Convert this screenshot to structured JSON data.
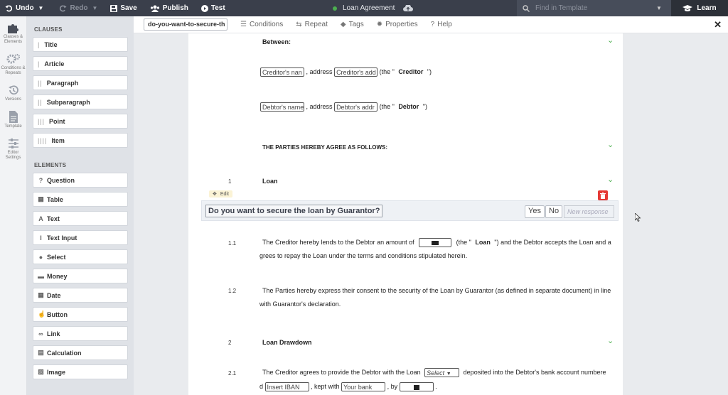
{
  "toolbar": {
    "undo": "Undo",
    "redo": "Redo",
    "save": "Save",
    "publish": "Publish",
    "test": "Test",
    "doc_title": "Loan Agreement",
    "search_placeholder": "Find in Template",
    "learn": "Learn"
  },
  "rail": [
    {
      "label": "Clauses & Elements",
      "icon": "puzzle-icon"
    },
    {
      "label": "Conditions & Repeats",
      "icon": "gears-icon"
    },
    {
      "label": "Versions",
      "icon": "history-icon"
    },
    {
      "label": "Template",
      "icon": "document-icon"
    },
    {
      "label": "Editor Settings",
      "icon": "sliders-icon"
    }
  ],
  "clauses": {
    "heading": "CLAUSES",
    "items": [
      {
        "label": "Title",
        "bars": "|"
      },
      {
        "label": "Article",
        "bars": "|"
      },
      {
        "label": "Paragraph",
        "bars": "||"
      },
      {
        "label": "Subparagraph",
        "bars": "||"
      },
      {
        "label": "Point",
        "bars": "|||"
      },
      {
        "label": "Item",
        "bars": "||||"
      }
    ]
  },
  "elements": {
    "heading": "ELEMENTS",
    "items": [
      {
        "label": "Question",
        "glyph": "?"
      },
      {
        "label": "Table",
        "glyph": "▦"
      },
      {
        "label": "Text",
        "glyph": "A"
      },
      {
        "label": "Text Input",
        "glyph": "I"
      },
      {
        "label": "Select",
        "glyph": "●"
      },
      {
        "label": "Money",
        "glyph": "▬"
      },
      {
        "label": "Date",
        "glyph": "▦"
      },
      {
        "label": "Button",
        "glyph": "☝"
      },
      {
        "label": "Link",
        "glyph": "∞"
      },
      {
        "label": "Calculation",
        "glyph": "▤"
      },
      {
        "label": "Image",
        "glyph": "▨"
      }
    ]
  },
  "subbar": {
    "element_id": "do-you-want-to-secure-th",
    "conditions": "Conditions",
    "repeat": "Repeat",
    "tags": "Tags",
    "properties": "Properties",
    "help": "Help"
  },
  "doc": {
    "between": "Between:",
    "creditor_name": "Creditor's nan",
    "creditor_addr": "Creditor's add",
    "address_word": ", address",
    "the_open": "(the \"",
    "close_paren": "\")",
    "creditor": "Creditor",
    "debtor_name": "Debtor's name",
    "debtor_addr": "Debtor's addr",
    "debtor": "Debtor",
    "agree": "THE PARTIES HEREBY AGREE AS FOLLOWS:",
    "num1": "1",
    "loan_heading": "Loan",
    "edit": "Edit",
    "question": "Do you want to secure the loan by Guarantor?",
    "yes": "Yes",
    "no": "No",
    "new_response": "New response",
    "num11": "1.1",
    "p11a": "The Creditor hereby lends to the Debtor an amount of",
    "p11b": "(the \"",
    "loan_word": "Loan",
    "p11c": "\") and the Debtor accepts the Loan and a",
    "p11d": "grees to repay the Loan under the terms and conditions stipulated herein.",
    "num12": "1.2",
    "p12a": "The Parties hereby express their consent to the security of the Loan by Guarantor (as defined in separate document) in line",
    "p12b": "with Guarantor's declaration.",
    "num2": "2",
    "drawdown_heading": "Loan Drawdown",
    "num21": "2.1",
    "p21a": "The Creditor agrees to provide the Debtor with the Loan",
    "select_label": "Select",
    "p21b": "deposited into the Debtor's bank account numbere",
    "p21c": "d",
    "iban": "Insert IBAN",
    "kept_with": ", kept with",
    "bank": "Your bank",
    "by": ", by",
    "period": "."
  },
  "colors": {
    "topbar": "#3a3f4b",
    "accent_green": "#4caf50",
    "danger": "#e53935",
    "panel": "#dfe2e7"
  }
}
